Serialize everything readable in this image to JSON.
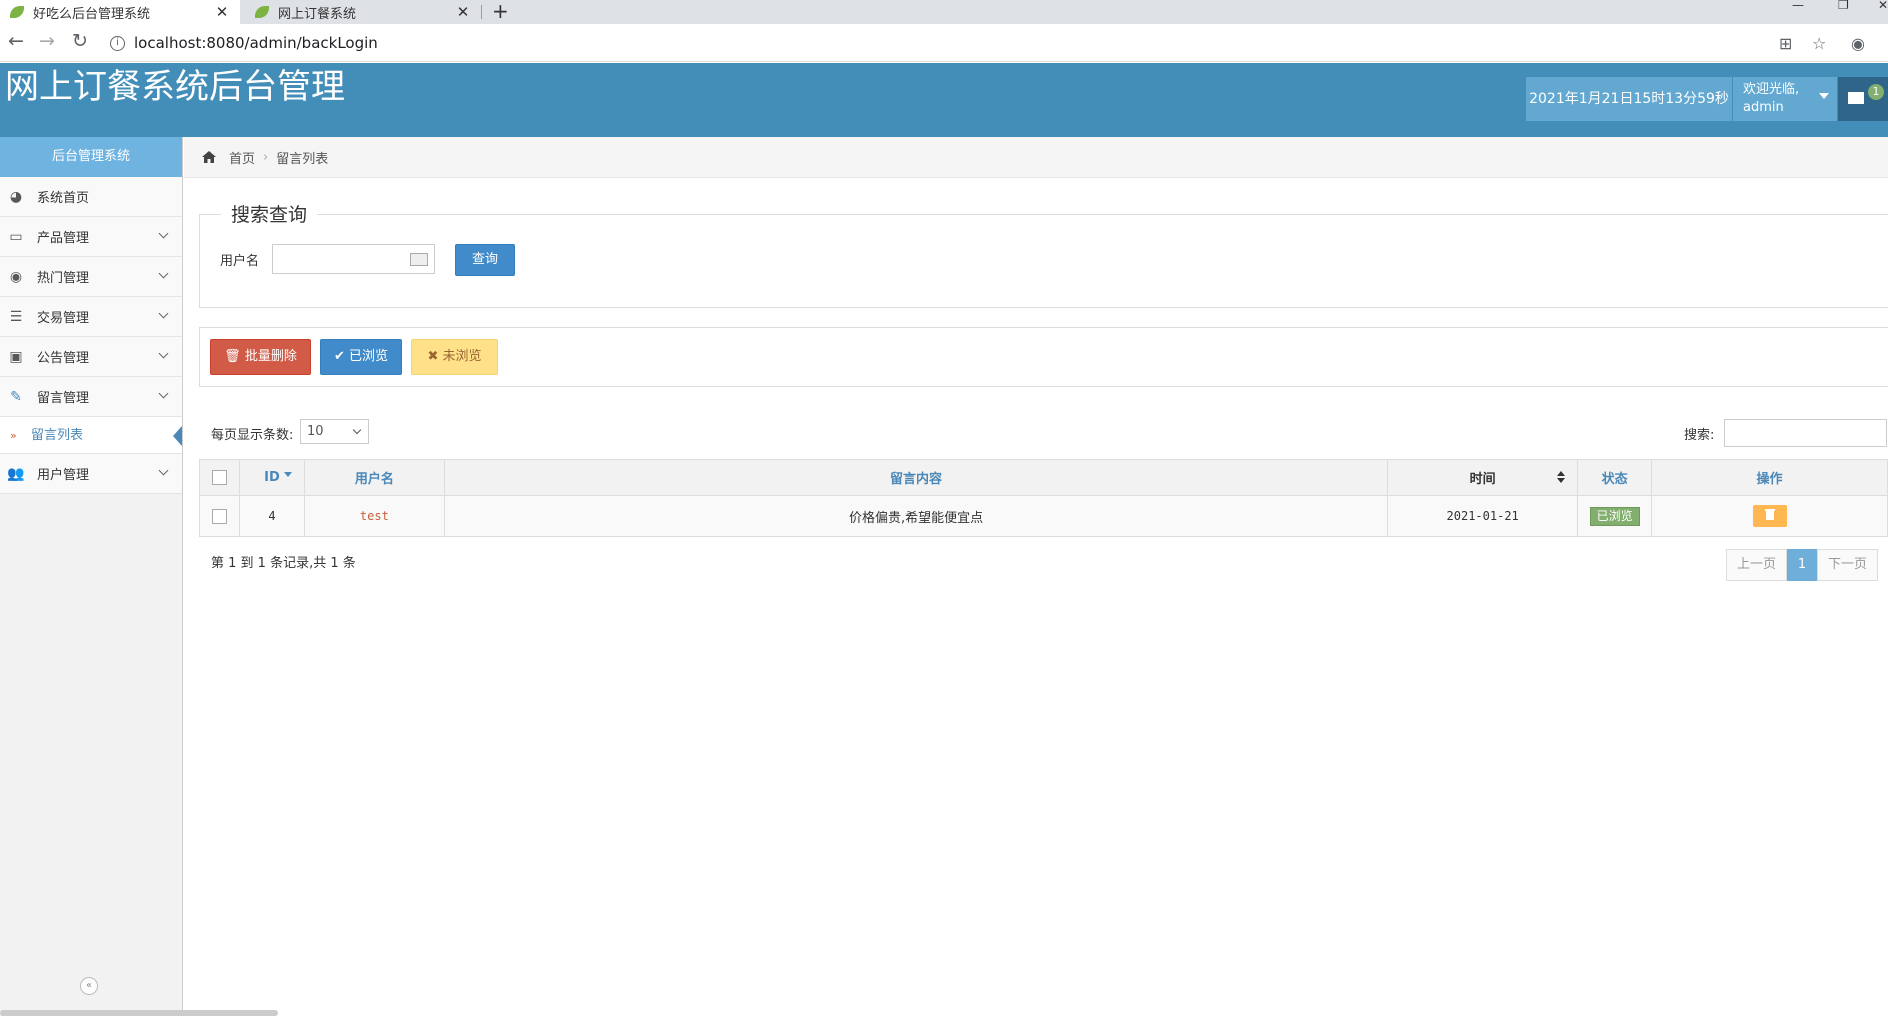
{
  "browser": {
    "tabs": [
      {
        "title": "好吃么后台管理系统"
      },
      {
        "title": "网上订餐系统"
      }
    ],
    "url": "localhost:8080/admin/backLogin"
  },
  "header": {
    "title": "网上订餐系统后台管理",
    "datetime": "2021年1月21日15时13分59秒",
    "welcome": "欢迎光临,",
    "username": "admin",
    "mail_count": "1"
  },
  "sidebar": {
    "title": "后台管理系统",
    "items": [
      {
        "label": "系统首页",
        "icon": "dashboard-icon"
      },
      {
        "label": "产品管理",
        "icon": "desktop-icon"
      },
      {
        "label": "热门管理",
        "icon": "eye-icon"
      },
      {
        "label": "交易管理",
        "icon": "list-icon"
      },
      {
        "label": "公告管理",
        "icon": "picture-icon"
      },
      {
        "label": "留言管理",
        "icon": "edit-icon"
      },
      {
        "label": "用户管理",
        "icon": "users-icon"
      }
    ],
    "active_sub": "留言列表"
  },
  "breadcrumb": {
    "home": "首页",
    "current": "留言列表"
  },
  "search": {
    "legend": "搜索查询",
    "username_label": "用户名",
    "query_button": "查询"
  },
  "actions": {
    "batch_delete": "批量删除",
    "mark_read": "已浏览",
    "mark_unread": "未浏览"
  },
  "table_controls": {
    "page_size_label": "每页显示条数:",
    "page_size": "10",
    "filter_label": "搜索:"
  },
  "table": {
    "columns": [
      "ID",
      "用户名",
      "留言内容",
      "时间",
      "状态",
      "操作"
    ],
    "rows": [
      {
        "id": "4",
        "username": "test",
        "content": "价格偏贵,希望能便宜点",
        "time": "2021-01-21",
        "status": "已浏览"
      }
    ]
  },
  "pagination": {
    "info": "第 1 到 1 条记录,共 1 条",
    "prev": "上一页",
    "current": "1",
    "next": "下一页"
  },
  "colors": {
    "header_bg": "#438eb9",
    "sidebar_head": "#6fb3e0",
    "danger": "#d15b47",
    "primary": "#428bca",
    "warning_light": "#fee188",
    "success": "#82af6f",
    "warning": "#ffb752"
  }
}
